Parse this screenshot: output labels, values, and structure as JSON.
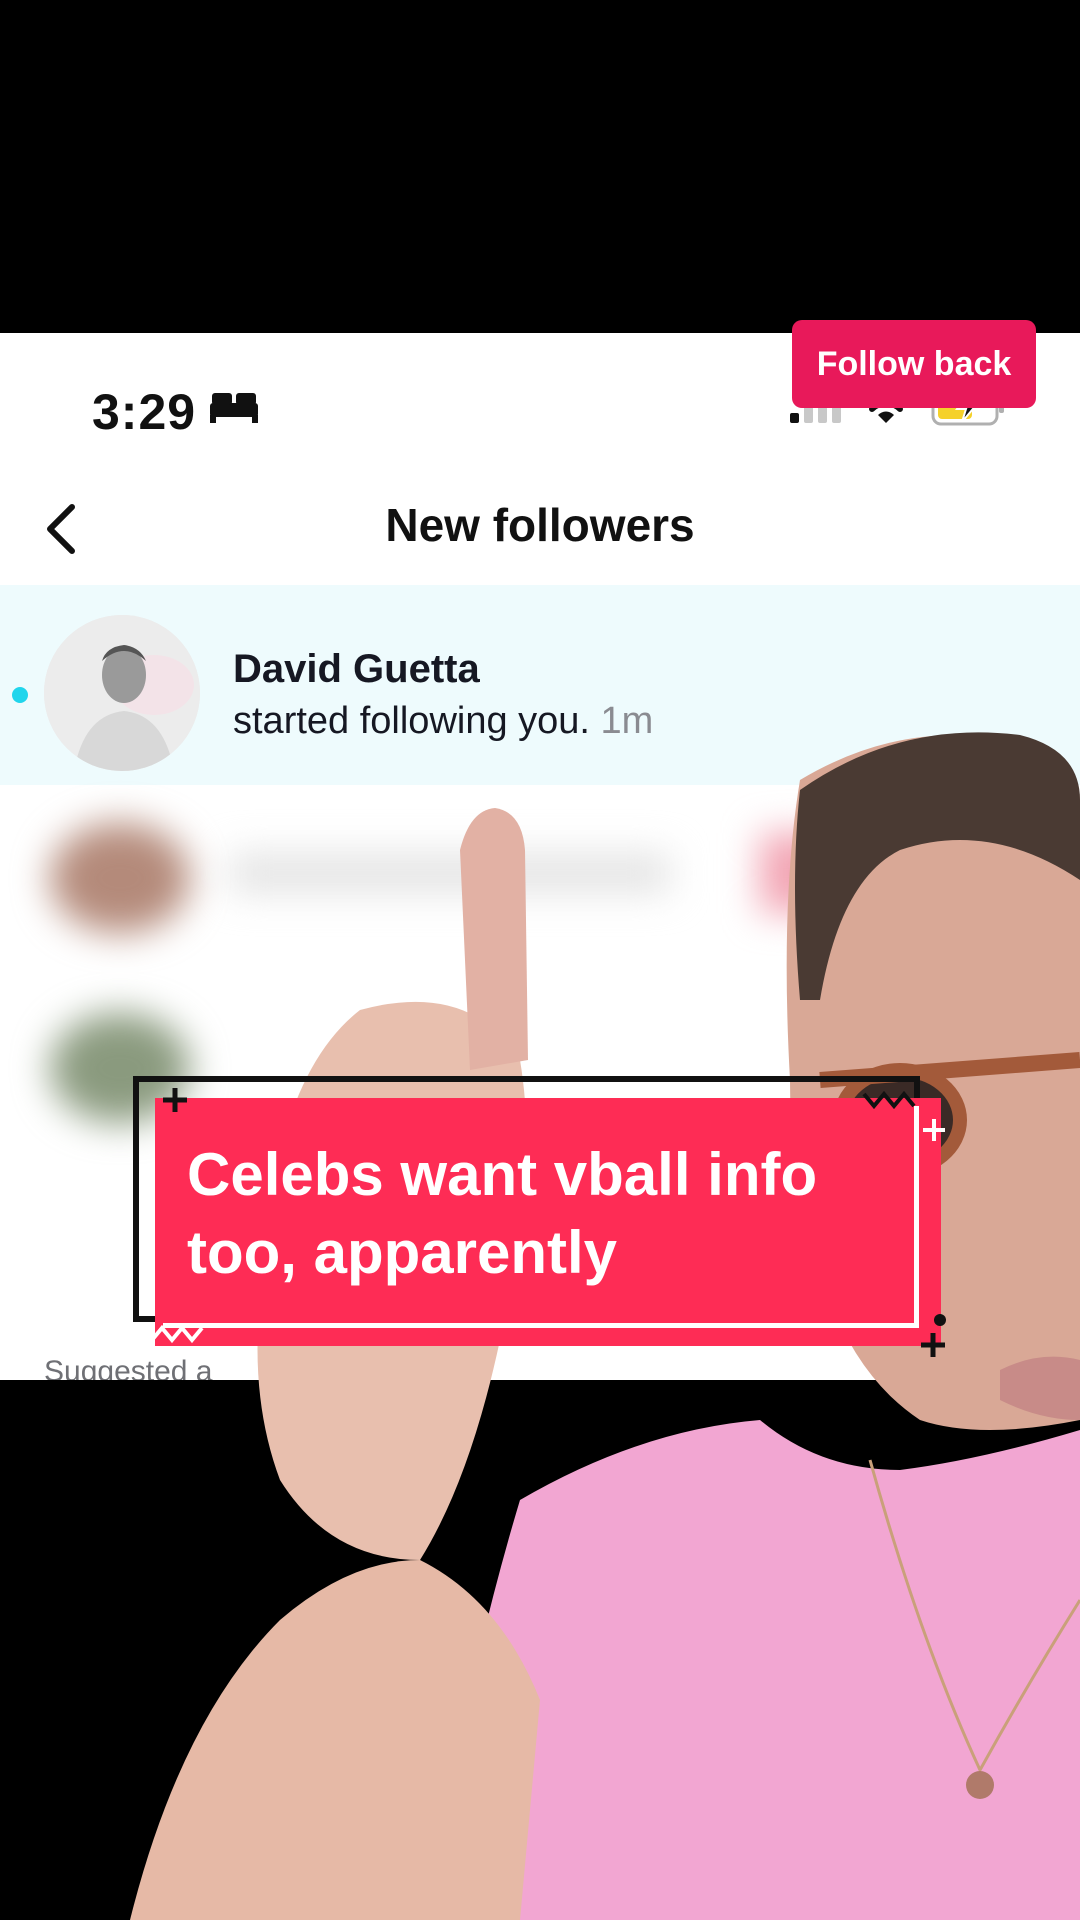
{
  "status_bar": {
    "time": "3:29",
    "icons": [
      "bed-icon",
      "signal-icon",
      "wifi-icon",
      "battery-charging-icon"
    ],
    "battery_color": "#f5d12a"
  },
  "header": {
    "back_icon": "chevron-left-icon",
    "title": "New followers"
  },
  "follower": {
    "name": "David Guetta",
    "action": "started following you.",
    "time": "1m",
    "button_label": "Follow back",
    "unread": true
  },
  "suggested": {
    "label": "Suggested a"
  },
  "caption": {
    "text": "Celebs want vball info too, apparently"
  },
  "colors": {
    "accent": "#fe2c55",
    "follow_button": "#e8195a",
    "unread_dot": "#20d5ec",
    "highlight_row": "#eefbfd"
  }
}
